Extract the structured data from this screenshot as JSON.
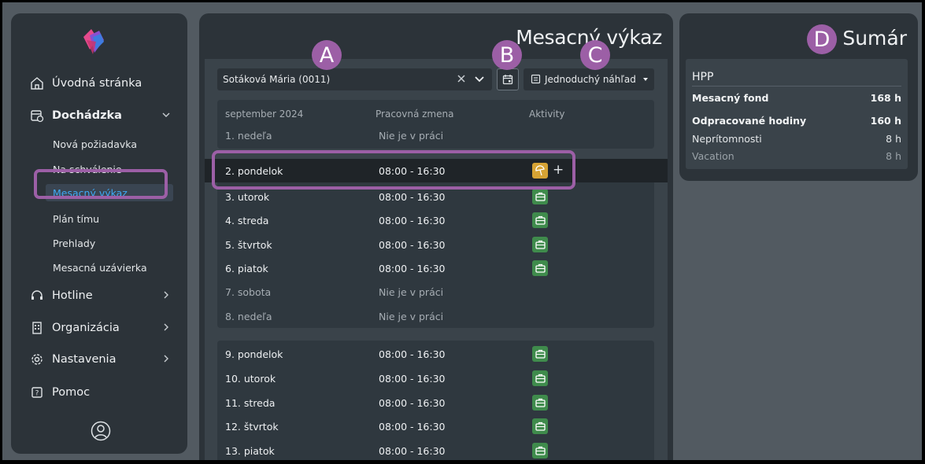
{
  "sidebar": {
    "items": [
      {
        "label": "Úvodná stránka",
        "icon": "home-icon"
      },
      {
        "label": "Dochádzka",
        "icon": "calendar-clock-icon"
      },
      {
        "label": "Hotline",
        "icon": "headset-icon"
      },
      {
        "label": "Organizácia",
        "icon": "building-icon"
      },
      {
        "label": "Nastavenia",
        "icon": "gear-icon"
      },
      {
        "label": "Pomoc",
        "icon": "help-icon"
      }
    ],
    "sub_items": [
      "Nová požiadavka",
      "Na schválenie",
      "Mesacný výkaz",
      "Plán tímu",
      "Prehlady",
      "Mesacná uzávierka"
    ],
    "active_sub": "Mesacný výkaz"
  },
  "main": {
    "title": "Mesacný výkaz",
    "employee": "Sotáková Mária (0011)",
    "view": "Jednoduchý náhľad",
    "headers": {
      "month": "september 2024",
      "shift": "Pracovná zmena",
      "activities": "Aktivity"
    },
    "rows": [
      {
        "day": "1. nedeľa",
        "shift": "Nie je v práci",
        "activity": "none"
      },
      {
        "day": "2. pondelok",
        "shift": "08:00 - 16:30",
        "activity": "vacation"
      },
      {
        "day": "3. utorok",
        "shift": "08:00 - 16:30",
        "activity": "work"
      },
      {
        "day": "4. streda",
        "shift": "08:00 - 16:30",
        "activity": "work"
      },
      {
        "day": "5. štvrtok",
        "shift": "08:00 - 16:30",
        "activity": "work"
      },
      {
        "day": "6. piatok",
        "shift": "08:00 - 16:30",
        "activity": "work"
      },
      {
        "day": "7. sobota",
        "shift": "Nie je v práci",
        "activity": "none"
      },
      {
        "day": "8. nedeľa",
        "shift": "Nie je v práci",
        "activity": "none"
      },
      {
        "day": "9. pondelok",
        "shift": "08:00 - 16:30",
        "activity": "work"
      },
      {
        "day": "10. utorok",
        "shift": "08:00 - 16:30",
        "activity": "work"
      },
      {
        "day": "11. streda",
        "shift": "08:00 - 16:30",
        "activity": "work"
      },
      {
        "day": "12. štvrtok",
        "shift": "08:00 - 16:30",
        "activity": "work"
      },
      {
        "day": "13. piatok",
        "shift": "08:00 - 16:30",
        "activity": "work"
      }
    ]
  },
  "summary": {
    "title": "Sumár",
    "contract": "HPP",
    "rows": [
      {
        "label": "Mesacný fond",
        "value": "168 h"
      },
      {
        "label": "Odpracované hodiny",
        "value": "160 h"
      },
      {
        "label": "Neprítomnosti",
        "value": "8 h"
      },
      {
        "label": "Vacation",
        "value": "8 h"
      }
    ]
  },
  "badges": {
    "a": "A",
    "b": "B",
    "c": "C",
    "d": "D"
  },
  "colors": {
    "accent": "#9c5fa6",
    "active_link": "#3fa9f5",
    "work": "#3f8b4c",
    "vacation": "#d6a334"
  }
}
